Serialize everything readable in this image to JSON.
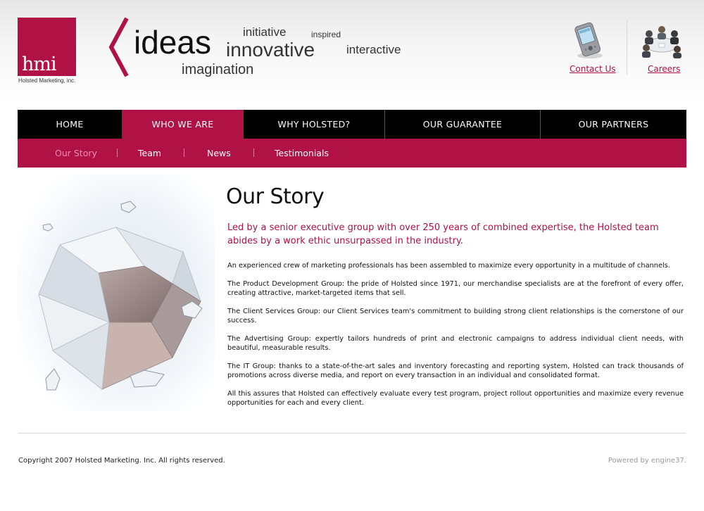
{
  "header": {
    "logo_text": "hmi",
    "company_name": "Holsted Marketing, inc.",
    "tagline_words": {
      "ideas": "ideas",
      "initiative": "initiative",
      "inspired": "inspired",
      "innovative": "innovative",
      "interactive": "interactive",
      "imagination": "imagination"
    },
    "contact_label": "Contact Us",
    "careers_label": "Careers"
  },
  "colors": {
    "brand": "#b01245",
    "nav_bg": "#000000",
    "subnav_current": "#ef8fb0"
  },
  "nav": {
    "items": [
      {
        "label": "HOME"
      },
      {
        "label": "WHO WE ARE"
      },
      {
        "label": "WHY HOLSTED?"
      },
      {
        "label": "OUR GUARANTEE"
      },
      {
        "label": "OUR PARTNERS"
      }
    ],
    "active": "WHO WE ARE"
  },
  "subnav": {
    "items": [
      {
        "label": "Our Story"
      },
      {
        "label": "Team"
      },
      {
        "label": "News"
      },
      {
        "label": "Testimonials"
      }
    ],
    "current": "Our Story"
  },
  "content": {
    "title": "Our Story",
    "lead": "Led by a senior executive group with over 250 years of combined expertise, the Holsted team abides by a work ethic unsurpassed in the industry.",
    "paragraphs": [
      "An experienced crew of marketing professionals has been assembled to maximize every opportunity in a multitude of channels.",
      "The Product Development Group: the pride of Holsted since 1971, our merchandise specialists are at the forefront of every offer, creating attractive, market-targeted items that sell.",
      "The Client Services Group: our Client Services team's commitment to building strong client relationships is the cornerstone of our success.",
      "The Advertising Group: expertly tailors hundreds of print and electronic campaigns to address individual client needs, with beautiful, measurable results.",
      "The IT Group: thanks to a state-of-the-art sales and inventory forecasting and reporting system, Holsted can track thousands of promotions across diverse media, and report on every transaction in an individual and consolidated format.",
      "All this assures that Holsted can effectively evaluate every test program, project rollout opportunities and maximize every revenue opportunities for each and every client."
    ]
  },
  "footer": {
    "copyright": "Copyright 2007 Holsted Marketing. Inc. All rights reserved.",
    "powered_by": "Powered by engine37."
  }
}
